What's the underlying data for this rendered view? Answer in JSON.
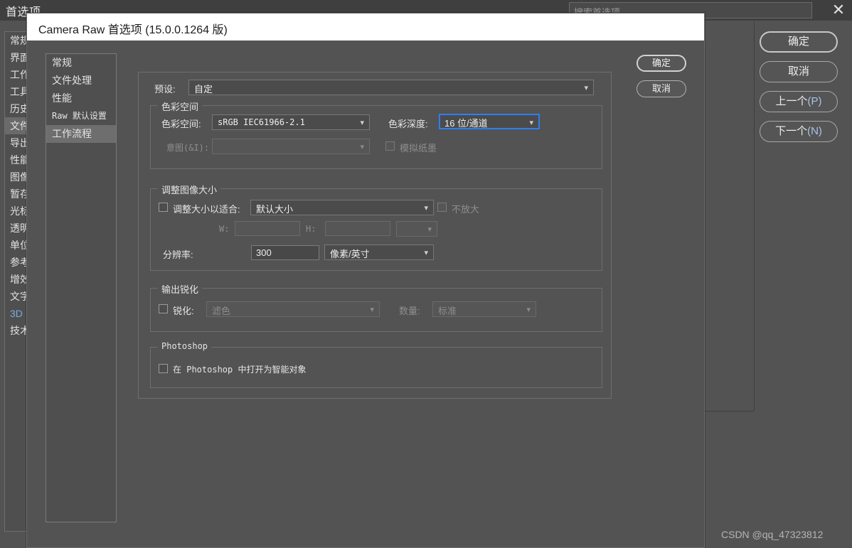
{
  "background": {
    "title": "首选项",
    "search_placeholder": "搜索首选项",
    "close_icon": "close-icon",
    "sidebar": [
      {
        "label": "常规",
        "selected": false
      },
      {
        "label": "界面",
        "selected": false
      },
      {
        "label": "工作",
        "selected": false
      },
      {
        "label": "工具",
        "selected": false
      },
      {
        "label": "历史",
        "selected": false
      },
      {
        "label": "文件",
        "selected": true
      },
      {
        "label": "导出",
        "selected": false
      },
      {
        "label": "性能",
        "selected": false
      },
      {
        "label": "图像",
        "selected": false
      },
      {
        "label": "暂存",
        "selected": false
      },
      {
        "label": "光标",
        "selected": false
      },
      {
        "label": "透明",
        "selected": false
      },
      {
        "label": "单位",
        "selected": false
      },
      {
        "label": "参考",
        "selected": false
      },
      {
        "label": "增效",
        "selected": false
      },
      {
        "label": "文字",
        "selected": false
      },
      {
        "label": "3D",
        "selected": false
      },
      {
        "label": "技术",
        "selected": false
      }
    ],
    "buttons": {
      "ok": "确定",
      "cancel": "取消",
      "prev": "上一个",
      "prev_mnemonic": "(P)",
      "next": "下一个",
      "next_mnemonic": "(N)"
    }
  },
  "watermark": "CSDN @qq_47323812",
  "dialog": {
    "title": "Camera Raw 首选项  (15.0.0.1264 版)",
    "sidebar": [
      {
        "label": "常规",
        "selected": false,
        "mono": false
      },
      {
        "label": "文件处理",
        "selected": false,
        "mono": false
      },
      {
        "label": "性能",
        "selected": false,
        "mono": false
      },
      {
        "label": "Raw 默认设置",
        "selected": false,
        "mono": true
      },
      {
        "label": "工作流程",
        "selected": true,
        "mono": false
      }
    ],
    "buttons": {
      "ok": "确定",
      "cancel": "取消"
    },
    "preset": {
      "label": "预设:",
      "value": "自定"
    },
    "color_space": {
      "legend": "色彩空间",
      "space_label": "色彩空间:",
      "space_value": "sRGB IEC61966-2.1",
      "depth_label": "色彩深度:",
      "depth_value": "16 位/通道",
      "intent_label": "意图(&I):",
      "intent_value": "",
      "simulate_label": "模拟纸墨"
    },
    "resize": {
      "legend": "调整图像大小",
      "fit_label": "调整大小以适合:",
      "fit_value": "默认大小",
      "no_enlarge_label": "不放大",
      "w_label": "W:",
      "w_value": "",
      "h_label": "H:",
      "h_value": "",
      "unit_value": "",
      "res_label": "分辨率:",
      "res_value": "300",
      "res_unit": "像素/英寸"
    },
    "sharpen": {
      "legend": "输出锐化",
      "sharpen_label": "锐化:",
      "sharpen_value": "滤色",
      "amount_label": "数量:",
      "amount_value": "标准"
    },
    "photoshop": {
      "legend": "Photoshop",
      "smart_object_label": "在 Photoshop 中打开为智能对象"
    }
  },
  "colors": {
    "dialog_bg": "#535353",
    "titlebar": "#ffffff",
    "focus_blue": "#2d7ff0",
    "selection": "#6e6e6e"
  }
}
